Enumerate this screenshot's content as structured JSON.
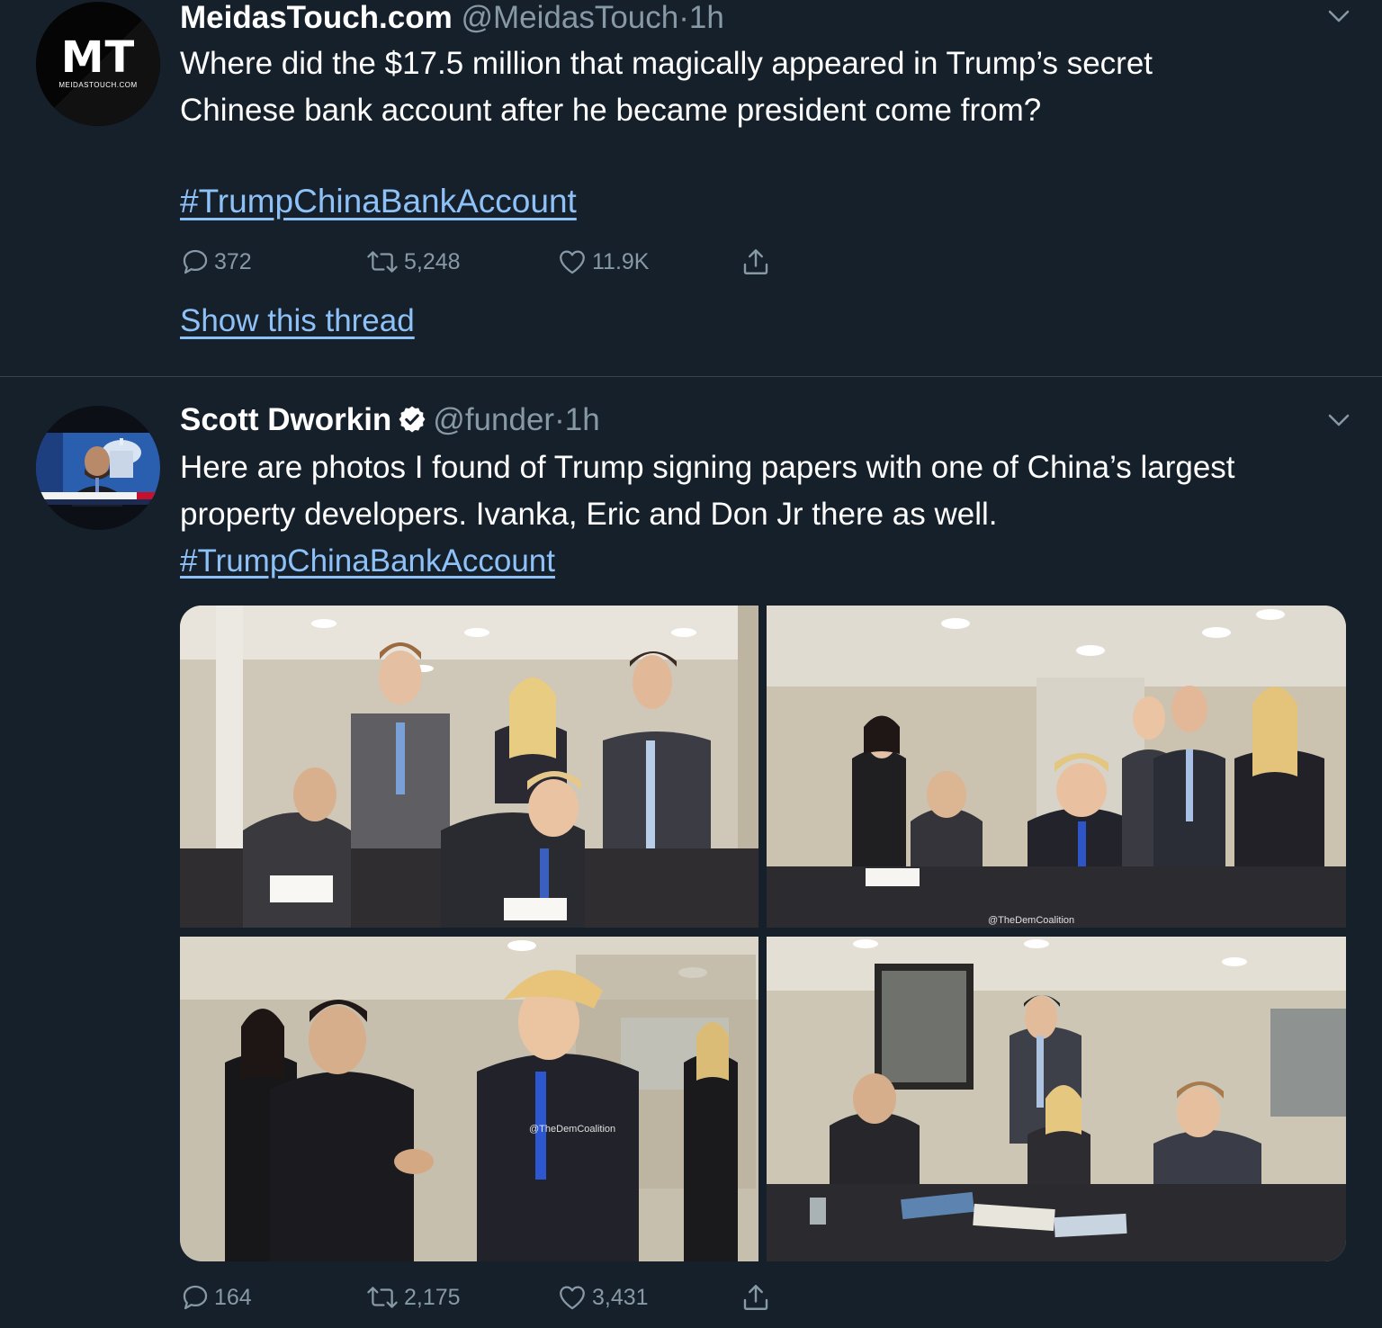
{
  "tweets": [
    {
      "avatar": {
        "letters": "MT",
        "subtitle": "MEIDASTOUCH.COM"
      },
      "author": "MeidasTouch.com",
      "handle": "@MeidasTouch",
      "separator": "·",
      "time": "1h",
      "verified": false,
      "text_lines": [
        "Where did the $17.5 million that magically appeared in Trump’s secret",
        "Chinese bank account after he became president come from?"
      ],
      "hashtag": "#TrumpChinaBankAccount",
      "counts": {
        "replies": "372",
        "retweets": "5,248",
        "likes": "11.9K"
      },
      "show_thread": "Show this thread"
    },
    {
      "avatar": {
        "description": "man-in-news-studio"
      },
      "author": "Scott Dworkin",
      "handle": "@funder",
      "separator": "·",
      "time": "1h",
      "verified": true,
      "text_lines": [
        "Here are photos I found of Trump signing papers with one of China’s largest",
        "property developers. Ivanka, Eric and Don Jr there as well."
      ],
      "hashtag": "#TrumpChinaBankAccount",
      "media": {
        "watermarks": [
          "@TheDemCoalition",
          "@TheDemCoalition"
        ]
      },
      "counts": {
        "replies": "164",
        "retweets": "2,175",
        "likes": "3,431"
      }
    }
  ],
  "icons": {
    "reply": "reply-icon",
    "retweet": "retweet-icon",
    "like": "heart-icon",
    "share": "share-icon",
    "menu": "chevron-down-icon",
    "verified": "verified-badge-icon"
  },
  "colors": {
    "background": "#15202b",
    "text": "#ffffff",
    "secondary": "#8899a6",
    "link": "#8ec1f7",
    "divider": "#38444d",
    "verified": "#ffffff"
  }
}
